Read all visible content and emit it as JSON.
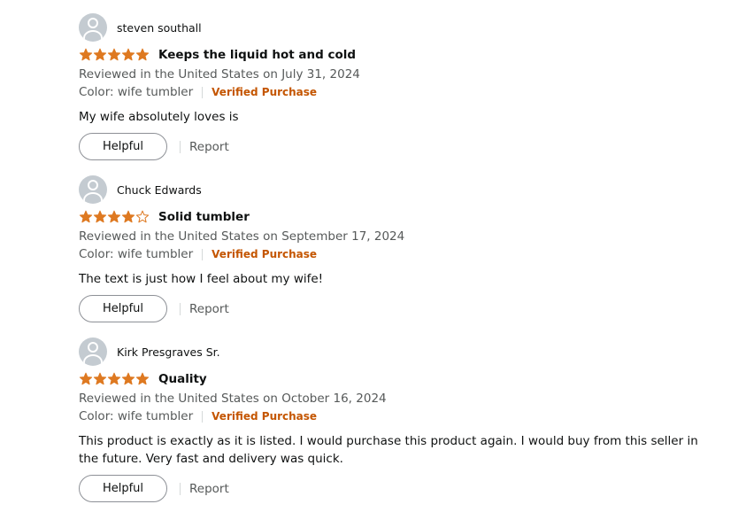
{
  "colors": {
    "star": "#de7921",
    "verified": "#c45500",
    "meta": "#565959",
    "text": "#0f1111"
  },
  "reviews": [
    {
      "reviewer": "steven southall",
      "rating": 5,
      "title": "Keeps the liquid hot and cold",
      "review_meta": "Reviewed in the United States on July 31, 2024",
      "variant": "Color: wife tumbler",
      "verified": "Verified Purchase",
      "body": "My wife absolutely loves is",
      "helpful_label": "Helpful",
      "report_label": "Report"
    },
    {
      "reviewer": "Chuck Edwards",
      "rating": 4,
      "title": "Solid tumbler",
      "review_meta": "Reviewed in the United States on September 17, 2024",
      "variant": "Color: wife tumbler",
      "verified": "Verified Purchase",
      "body": "The text is just how I feel about my wife!",
      "helpful_label": "Helpful",
      "report_label": "Report"
    },
    {
      "reviewer": "Kirk Presgraves Sr.",
      "rating": 5,
      "title": "Quality",
      "review_meta": "Reviewed in the United States on October 16, 2024",
      "variant": "Color: wife tumbler",
      "verified": "Verified Purchase",
      "body": "This product is exactly as it is listed. I would purchase this product again. I would buy from this seller in the future. Very fast and delivery was quick.",
      "helpful_label": "Helpful",
      "report_label": "Report"
    }
  ]
}
